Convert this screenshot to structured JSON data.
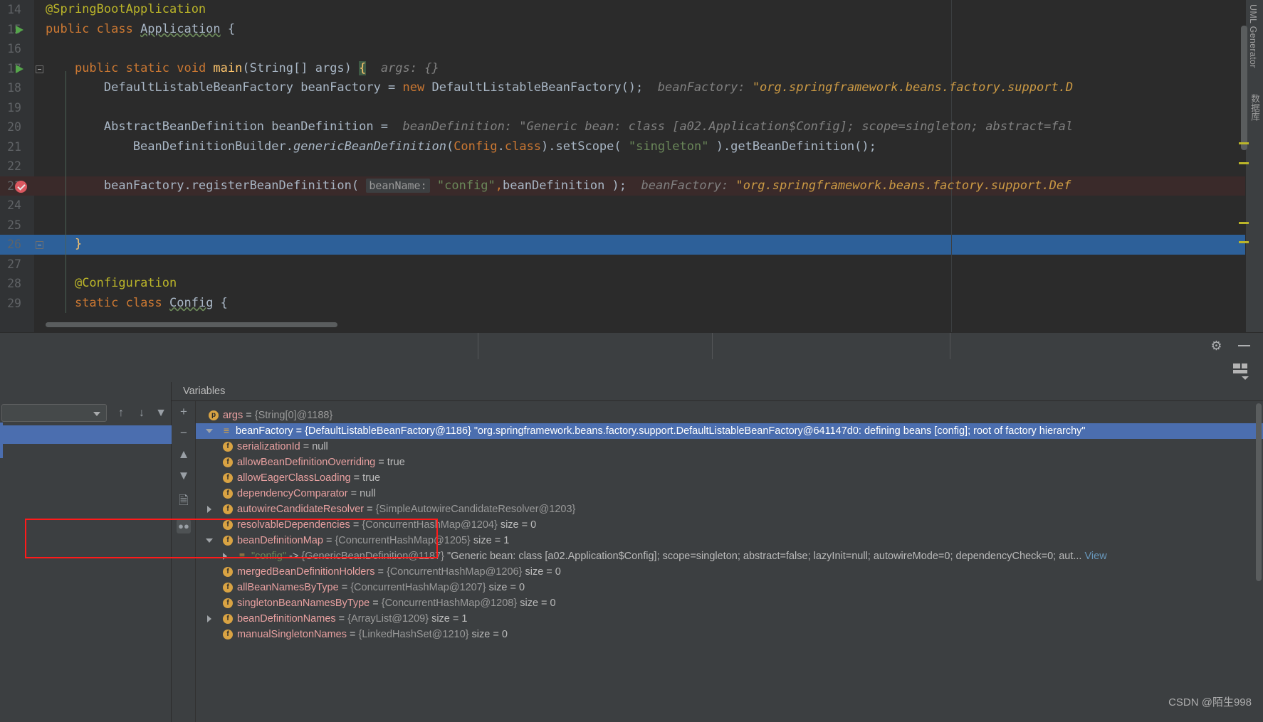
{
  "editor": {
    "lines": [
      {
        "num": "14",
        "marker": "none",
        "text": "@SpringBootApplication"
      },
      {
        "num": "15",
        "marker": "run",
        "text": "public class Application {"
      },
      {
        "num": "16",
        "marker": "none",
        "text": ""
      },
      {
        "num": "17",
        "marker": "run",
        "text": "public static void main(String[] args) {   args: {}"
      },
      {
        "num": "18",
        "marker": "none",
        "text": "DefaultListableBeanFactory beanFactory = new DefaultListableBeanFactory();   beanFactory: \"org.springframework.beans.factory.support.D"
      },
      {
        "num": "19",
        "marker": "none",
        "text": ""
      },
      {
        "num": "20",
        "marker": "none",
        "text": "AbstractBeanDefinition beanDefinition =   beanDefinition: \"Generic bean: class [a02.Application$Config]; scope=singleton; abstract=fal"
      },
      {
        "num": "21",
        "marker": "none",
        "text": "BeanDefinitionBuilder.genericBeanDefinition(Config.class).setScope( \"singleton\" ).getBeanDefinition();"
      },
      {
        "num": "22",
        "marker": "none",
        "text": ""
      },
      {
        "num": "23",
        "marker": "breakpoint",
        "text": "beanFactory.registerBeanDefinition(  beanName: \"config\",beanDefinition );   beanFactory: \"org.springframework.beans.factory.support.Def"
      },
      {
        "num": "24",
        "marker": "none",
        "text": ""
      },
      {
        "num": "25",
        "marker": "none",
        "text": ""
      },
      {
        "num": "26",
        "marker": "none",
        "text": "}"
      },
      {
        "num": "27",
        "marker": "none",
        "text": ""
      },
      {
        "num": "28",
        "marker": "none",
        "text": "@Configuration"
      },
      {
        "num": "29",
        "marker": "none",
        "text": "static class Config {"
      }
    ],
    "right_tab_labels": [
      "UML Generator",
      "数据库"
    ]
  },
  "debug": {
    "frames_toolbar": {
      "dropdown_value": "",
      "up_icon": "arrow-up-icon",
      "down_icon": "arrow-down-icon",
      "filter_icon": "filter-icon"
    },
    "variables_title": "Variables",
    "side_buttons": [
      "plus-icon",
      "minus-icon",
      "up-triangle-icon",
      "down-triangle-icon",
      "copy-icon",
      "glasses-icon"
    ],
    "rows": [
      {
        "indent": 0,
        "twisty": "none",
        "icon": "param",
        "icon_glyph": "p",
        "name": "args",
        "eq": " = ",
        "meta": "{String[0]@1188}",
        "value": "",
        "selected": false
      },
      {
        "indent": 0,
        "twisty": "open",
        "icon": "objref",
        "icon_glyph": "≡",
        "name": "beanFactory",
        "eq": " = ",
        "meta": "{DefaultListableBeanFactory@1186}",
        "value": " \"org.springframework.beans.factory.support.DefaultListableBeanFactory@641147d0: defining beans [config]; root of factory hierarchy\"",
        "selected": true
      },
      {
        "indent": 1,
        "twisty": "none",
        "icon": "field",
        "icon_glyph": "f",
        "name": "serializationId",
        "eq": " = ",
        "meta": "",
        "value": "null",
        "selected": false
      },
      {
        "indent": 1,
        "twisty": "none",
        "icon": "field",
        "icon_glyph": "f",
        "name": "allowBeanDefinitionOverriding",
        "eq": " = ",
        "meta": "",
        "value": "true",
        "selected": false
      },
      {
        "indent": 1,
        "twisty": "none",
        "icon": "field",
        "icon_glyph": "f",
        "name": "allowEagerClassLoading",
        "eq": " = ",
        "meta": "",
        "value": "true",
        "selected": false
      },
      {
        "indent": 1,
        "twisty": "none",
        "icon": "field",
        "icon_glyph": "f",
        "name": "dependencyComparator",
        "eq": " = ",
        "meta": "",
        "value": "null",
        "selected": false
      },
      {
        "indent": 1,
        "twisty": "closed",
        "icon": "field",
        "icon_glyph": "f",
        "name": "autowireCandidateResolver",
        "eq": " = ",
        "meta": "{SimpleAutowireCandidateResolver@1203}",
        "value": "",
        "selected": false
      },
      {
        "indent": 1,
        "twisty": "none",
        "icon": "field",
        "icon_glyph": "f",
        "name": "resolvableDependencies",
        "eq": " = ",
        "meta": "{ConcurrentHashMap@1204}",
        "value": "  size = 0",
        "selected": false
      },
      {
        "indent": 1,
        "twisty": "open",
        "icon": "field",
        "icon_glyph": "f",
        "name": "beanDefinitionMap",
        "eq": " = ",
        "meta": "{ConcurrentHashMap@1205}",
        "value": "  size = 1",
        "selected": false
      },
      {
        "indent": 2,
        "twisty": "closed",
        "icon": "objref",
        "icon_glyph": "≡",
        "name": "\"config\"",
        "name_kind": "string",
        "eq": " -> ",
        "meta": "{GenericBeanDefinition@1187}",
        "value": " \"Generic bean: class [a02.Application$Config]; scope=singleton; abstract=false; lazyInit=null; autowireMode=0; dependencyCheck=0; aut...",
        "view_link": "View",
        "selected": false
      },
      {
        "indent": 1,
        "twisty": "none",
        "icon": "field",
        "icon_glyph": "f",
        "name": "mergedBeanDefinitionHolders",
        "eq": " = ",
        "meta": "{ConcurrentHashMap@1206}",
        "value": "  size = 0",
        "selected": false
      },
      {
        "indent": 1,
        "twisty": "none",
        "icon": "field",
        "icon_glyph": "f",
        "name": "allBeanNamesByType",
        "eq": " = ",
        "meta": "{ConcurrentHashMap@1207}",
        "value": "  size = 0",
        "selected": false
      },
      {
        "indent": 1,
        "twisty": "none",
        "icon": "field",
        "icon_glyph": "f",
        "name": "singletonBeanNamesByType",
        "eq": " = ",
        "meta": "{ConcurrentHashMap@1208}",
        "value": "  size = 0",
        "selected": false
      },
      {
        "indent": 1,
        "twisty": "closed",
        "icon": "field",
        "icon_glyph": "f",
        "name": "beanDefinitionNames",
        "eq": " = ",
        "meta": "{ArrayList@1209}",
        "value": "  size = 1",
        "selected": false
      },
      {
        "indent": 1,
        "twisty": "none",
        "icon": "field",
        "icon_glyph": "f",
        "name": "manualSingletonNames",
        "eq": " = ",
        "meta": "{LinkedHashSet@1210}",
        "value": "  size = 0",
        "selected": false
      }
    ]
  },
  "watermark": "CSDN @陌生998",
  "colors": {
    "editor_bg": "#2b2b2b",
    "gutter_bg": "#313335",
    "panel_bg": "#3c3f41",
    "selection_blue": "#4b6eaf",
    "exec_line": "#3a2a2a",
    "annotation_yellow": "#bbb529",
    "keyword_orange": "#cc7832",
    "string_green": "#6a8759",
    "method_yellow": "#ffc66d",
    "field_red": "#e8a0a0",
    "highlight_box_red": "#ff1a1a"
  }
}
